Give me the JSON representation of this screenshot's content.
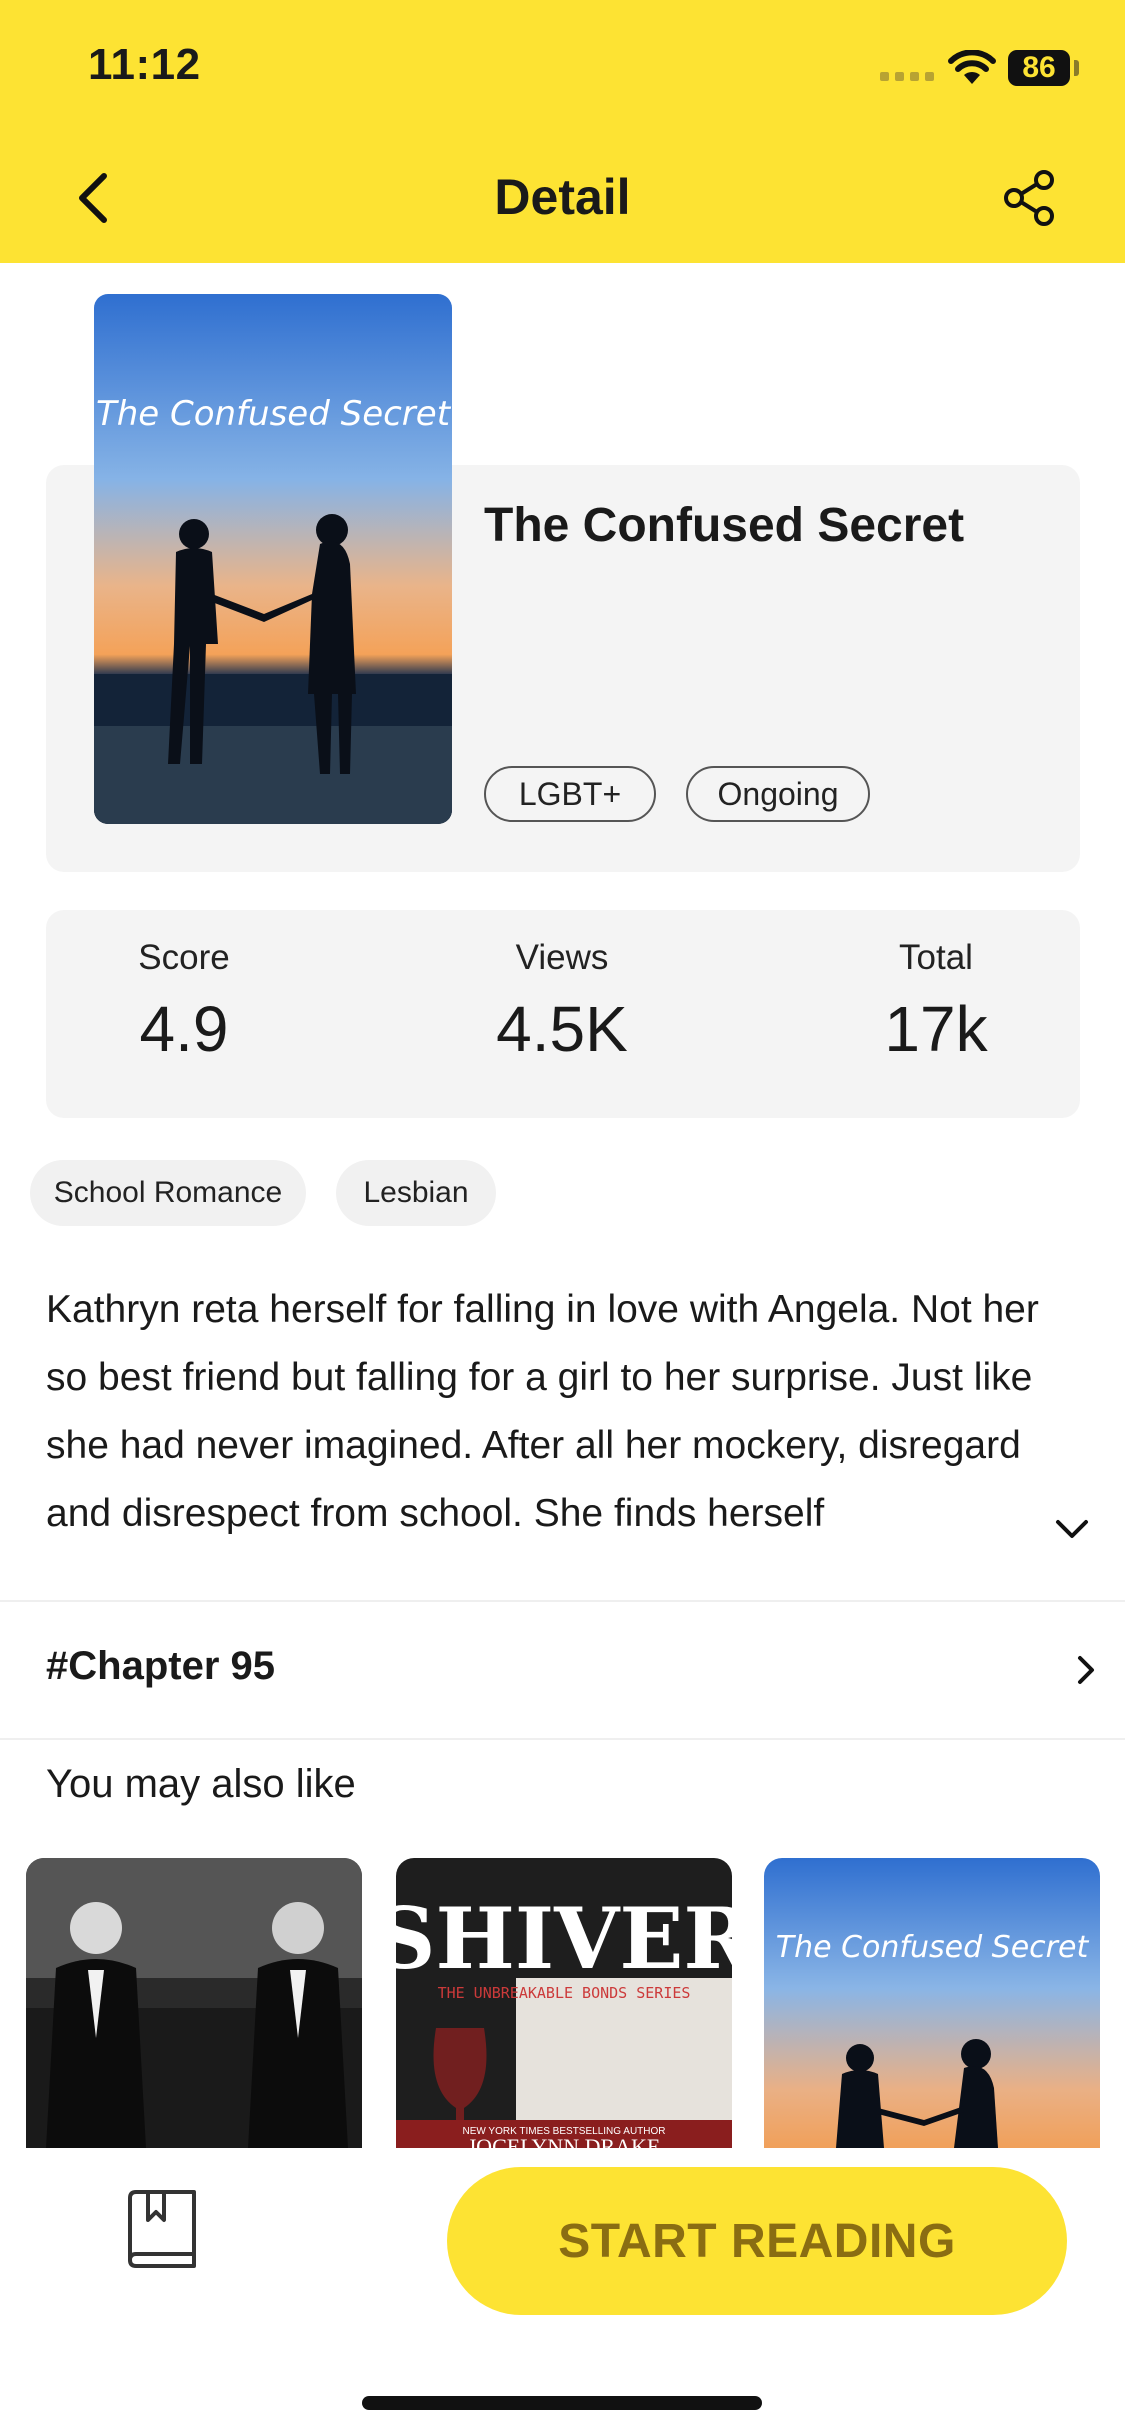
{
  "status_bar": {
    "time": "11:12",
    "battery": "86"
  },
  "header": {
    "title": "Detail"
  },
  "book": {
    "cover_title": "The Confused Secret",
    "title": "The Confused Secret",
    "tags": [
      "LGBT+",
      "Ongoing"
    ]
  },
  "stats": [
    {
      "label": "Score",
      "value": "4.9"
    },
    {
      "label": "Views",
      "value": "4.5K"
    },
    {
      "label": "Total",
      "value": "17k"
    }
  ],
  "genres": [
    "School Romance",
    "Lesbian"
  ],
  "synopsis": "Kathryn reta herself for falling in love with Angela. Not her so best friend but falling for a girl to her surprise. Just like she had never imagined. After all her mockery, disregard and disrespect from school. She finds herself",
  "chapter": {
    "label": "#Chapter 95"
  },
  "recommendations": {
    "title": "You may also like",
    "books": [
      {
        "cover_text": ""
      },
      {
        "cover_text": "SHIVER",
        "cover_subtitle": "THE UNBREAKABLE BONDS SERIES",
        "cover_tagline": "NEW YORK TIMES BESTSELLING AUTHOR",
        "cover_author": "JOCELYNN DRAKE"
      },
      {
        "cover_text": "The Confused Secret"
      }
    ]
  },
  "actions": {
    "start_reading": "START READING"
  },
  "colors": {
    "accent": "#fde333",
    "button_text": "#8a6d12"
  }
}
